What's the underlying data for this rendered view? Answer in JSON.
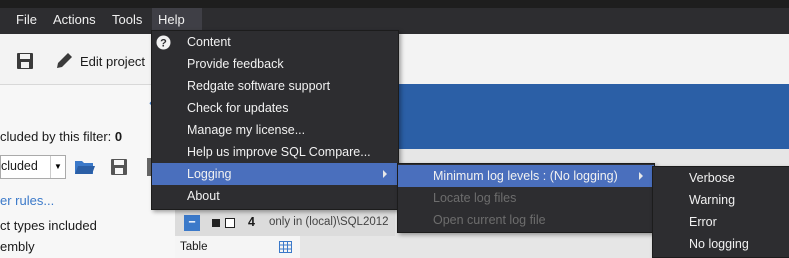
{
  "menubar": {
    "items": [
      "File",
      "Actions",
      "Tools",
      "Help"
    ]
  },
  "toolbar": {
    "edit_project": "Edit project"
  },
  "left_panel": {
    "filter_text": "cluded by this filter:",
    "filter_count": "0",
    "select_value": "cluded",
    "rules_link": "er rules...",
    "types_text": "ct types included",
    "assembly_text": "embly"
  },
  "group_row": {
    "count": "4",
    "label": "only in (local)\\SQL2012"
  },
  "table_header": {
    "label": "Table"
  },
  "help_menu": {
    "items": [
      "Content",
      "Provide feedback",
      "Redgate software support",
      "Check for updates",
      "Manage my license...",
      "Help us improve SQL Compare...",
      "Logging",
      "About"
    ]
  },
  "logging_menu": {
    "items": [
      "Minimum log levels : (No logging)",
      "Locate log files",
      "Open current log file"
    ]
  },
  "level_menu": {
    "items": [
      "Verbose",
      "Warning",
      "Error",
      "No logging"
    ]
  },
  "colors": {
    "menu_bg": "#2d2d30",
    "highlight": "#4a6fbd",
    "band": "#2b5fa6"
  }
}
